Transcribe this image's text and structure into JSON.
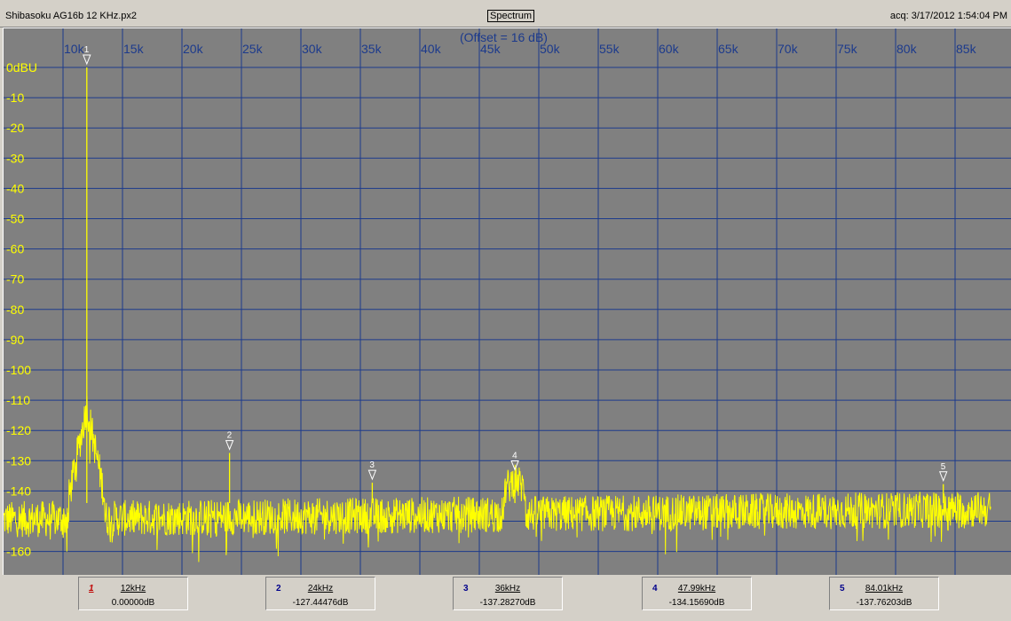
{
  "window": {
    "file_name": "Shibasoku AG16b 12 KHz.px2",
    "mode_button": "Spectrum",
    "acq_label": "acq: 3/17/2012 1:54:04 PM"
  },
  "chart_data": {
    "type": "line",
    "title": "(Offset = 16 dB)",
    "x_unit": "Hz",
    "xlim": [
      5000,
      88000
    ],
    "ylim": [
      -166,
      4
    ],
    "x_ticks": [
      {
        "value": 10000,
        "label": "10k"
      },
      {
        "value": 15000,
        "label": "15k"
      },
      {
        "value": 20000,
        "label": "20k"
      },
      {
        "value": 25000,
        "label": "25k"
      },
      {
        "value": 30000,
        "label": "30k"
      },
      {
        "value": 35000,
        "label": "35k"
      },
      {
        "value": 40000,
        "label": "40k"
      },
      {
        "value": 45000,
        "label": "45k"
      },
      {
        "value": 50000,
        "label": "50k"
      },
      {
        "value": 55000,
        "label": "55k"
      },
      {
        "value": 60000,
        "label": "60k"
      },
      {
        "value": 65000,
        "label": "65k"
      },
      {
        "value": 70000,
        "label": "70k"
      },
      {
        "value": 75000,
        "label": "75k"
      },
      {
        "value": 80000,
        "label": "80k"
      },
      {
        "value": 85000,
        "label": "85k"
      }
    ],
    "y_ticks": [
      {
        "value": 0,
        "label": "0dBU"
      },
      {
        "value": -10,
        "label": "-10"
      },
      {
        "value": -20,
        "label": "-20"
      },
      {
        "value": -30,
        "label": "-30"
      },
      {
        "value": -40,
        "label": "-40"
      },
      {
        "value": -50,
        "label": "-50"
      },
      {
        "value": -60,
        "label": "-60"
      },
      {
        "value": -70,
        "label": "-70"
      },
      {
        "value": -80,
        "label": "-80"
      },
      {
        "value": -90,
        "label": "-90"
      },
      {
        "value": -100,
        "label": "-100"
      },
      {
        "value": -110,
        "label": "-110"
      },
      {
        "value": -120,
        "label": "-120"
      },
      {
        "value": -130,
        "label": "-130"
      },
      {
        "value": -140,
        "label": "-140"
      },
      {
        "value": -150,
        "label": ""
      },
      {
        "value": -160,
        "label": "-160"
      }
    ],
    "grid": true,
    "noise_floor_dB": -148,
    "series": [
      {
        "color": "#ffff00",
        "peaks": [
          {
            "x": 12000,
            "y": 0.0
          },
          {
            "x": 24000,
            "y": -127.44
          },
          {
            "x": 36000,
            "y": -137.28
          },
          {
            "x": 47990,
            "y": -134.16
          },
          {
            "x": 84010,
            "y": -137.76
          }
        ]
      }
    ],
    "markers": [
      {
        "num": "1",
        "x": 12000,
        "y": 0.0
      },
      {
        "num": "2",
        "x": 24000,
        "y": -127.44
      },
      {
        "num": "3",
        "x": 36000,
        "y": -137.28
      },
      {
        "num": "4",
        "x": 47990,
        "y": -134.16
      },
      {
        "num": "5",
        "x": 84010,
        "y": -137.76
      }
    ],
    "colors": {
      "background": "#808080",
      "grid": "#1c3a8c",
      "trace": "#ffff00",
      "axis_text_x": "#1c3a8c",
      "axis_text_y": "#ffff00",
      "marker": "#ffffff"
    }
  },
  "marker_table": [
    {
      "num": "1",
      "freq": "12kHz",
      "level": "0.00000dB"
    },
    {
      "num": "2",
      "freq": "24kHz",
      "level": "-127.44476dB"
    },
    {
      "num": "3",
      "freq": "36kHz",
      "level": "-137.28270dB"
    },
    {
      "num": "4",
      "freq": "47.99kHz",
      "level": "-134.15690dB"
    },
    {
      "num": "5",
      "freq": "84.01kHz",
      "level": "-137.76203dB"
    }
  ]
}
